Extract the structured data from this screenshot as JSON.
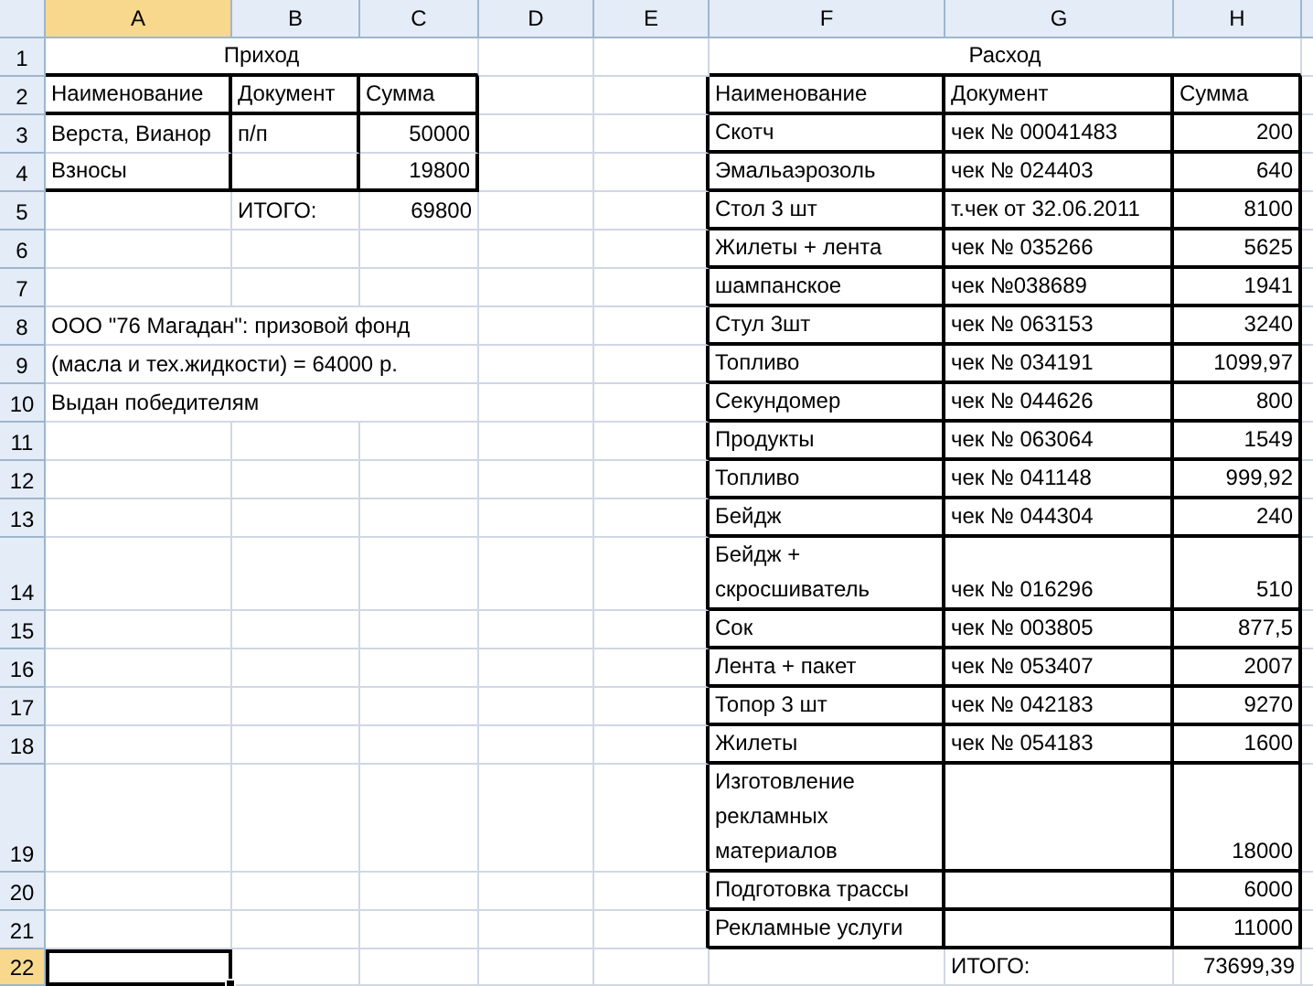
{
  "columns": [
    {
      "label": "A",
      "selected": true
    },
    {
      "label": "B",
      "selected": false
    },
    {
      "label": "C",
      "selected": false
    },
    {
      "label": "D",
      "selected": false
    },
    {
      "label": "E",
      "selected": false
    },
    {
      "label": "F",
      "selected": false
    },
    {
      "label": "G",
      "selected": false
    },
    {
      "label": "H",
      "selected": false
    }
  ],
  "row_numbers": [
    {
      "label": "1",
      "selected": false
    },
    {
      "label": "2",
      "selected": false
    },
    {
      "label": "3",
      "selected": false
    },
    {
      "label": "4",
      "selected": false
    },
    {
      "label": "5",
      "selected": false
    },
    {
      "label": "6",
      "selected": false
    },
    {
      "label": "7",
      "selected": false
    },
    {
      "label": "8",
      "selected": false
    },
    {
      "label": "9",
      "selected": false
    },
    {
      "label": "10",
      "selected": false
    },
    {
      "label": "11",
      "selected": false
    },
    {
      "label": "12",
      "selected": false
    },
    {
      "label": "13",
      "selected": false
    },
    {
      "label": "14",
      "selected": false
    },
    {
      "label": "15",
      "selected": false
    },
    {
      "label": "16",
      "selected": false
    },
    {
      "label": "17",
      "selected": false
    },
    {
      "label": "18",
      "selected": false
    },
    {
      "label": "19",
      "selected": false
    },
    {
      "label": "20",
      "selected": false
    },
    {
      "label": "21",
      "selected": false
    },
    {
      "label": "22",
      "selected": true
    }
  ],
  "income": {
    "title": "Приход",
    "columns": [
      "Наименование",
      "Документ",
      "Сумма"
    ],
    "rows": [
      {
        "name": "Верста, Вианор",
        "document": "п/п",
        "amount": "50000"
      },
      {
        "name": "Взносы",
        "document": "",
        "amount": "19800"
      }
    ],
    "total_label": "ИТОГО:",
    "total": "69800"
  },
  "note": [
    "ООО \"76 Магадан\": призовой фонд",
    "(масла и тех.жидкости) = 64000 р.",
    "Выдан победителям"
  ],
  "expense": {
    "title": "Расход",
    "columns": [
      "Наименование",
      "Документ",
      "Сумма"
    ],
    "rows": [
      {
        "name": "Скотч",
        "document": "чек № 00041483",
        "amount": "200"
      },
      {
        "name": "Эмальаэрозоль",
        "document": "чек № 024403",
        "amount": "640"
      },
      {
        "name": "Стол 3 шт",
        "document": "т.чек от 32.06.2011",
        "amount": "8100"
      },
      {
        "name": "Жилеты + лента",
        "document": "чек № 035266",
        "amount": "5625"
      },
      {
        "name": "шампанское",
        "document": "чек №038689",
        "amount": "1941"
      },
      {
        "name": "Стул 3шт",
        "document": "чек № 063153",
        "amount": "3240"
      },
      {
        "name": "Топливо",
        "document": "чек № 034191",
        "amount": "1099,97"
      },
      {
        "name": "Секундомер",
        "document": "чек № 044626",
        "amount": "800"
      },
      {
        "name": "Продукты",
        "document": "чек № 063064",
        "amount": "1549"
      },
      {
        "name": "Топливо",
        "document": "чек № 041148",
        "amount": "999,92"
      },
      {
        "name": "Бейдж",
        "document": "чек № 044304",
        "amount": "240"
      },
      {
        "name": "Бейдж + скросшиватель",
        "document": "чек № 016296",
        "amount": "510"
      },
      {
        "name": "Сок",
        "document": "чек № 003805",
        "amount": "877,5"
      },
      {
        "name": "Лента + пакет",
        "document": "чек № 053407",
        "amount": "2007"
      },
      {
        "name": "Топор 3 шт",
        "document": "чек № 042183",
        "amount": "9270"
      },
      {
        "name": "Жилеты",
        "document": "чек № 054183",
        "amount": "1600"
      },
      {
        "name": "Изготовление рекламных материалов",
        "document": "",
        "amount": "18000"
      },
      {
        "name": "Подготовка трассы",
        "document": "",
        "amount": "6000"
      },
      {
        "name": "Рекламные услуги",
        "document": "",
        "amount": "11000"
      }
    ],
    "total_label": "ИТОГО:",
    "total": "73699,39"
  }
}
